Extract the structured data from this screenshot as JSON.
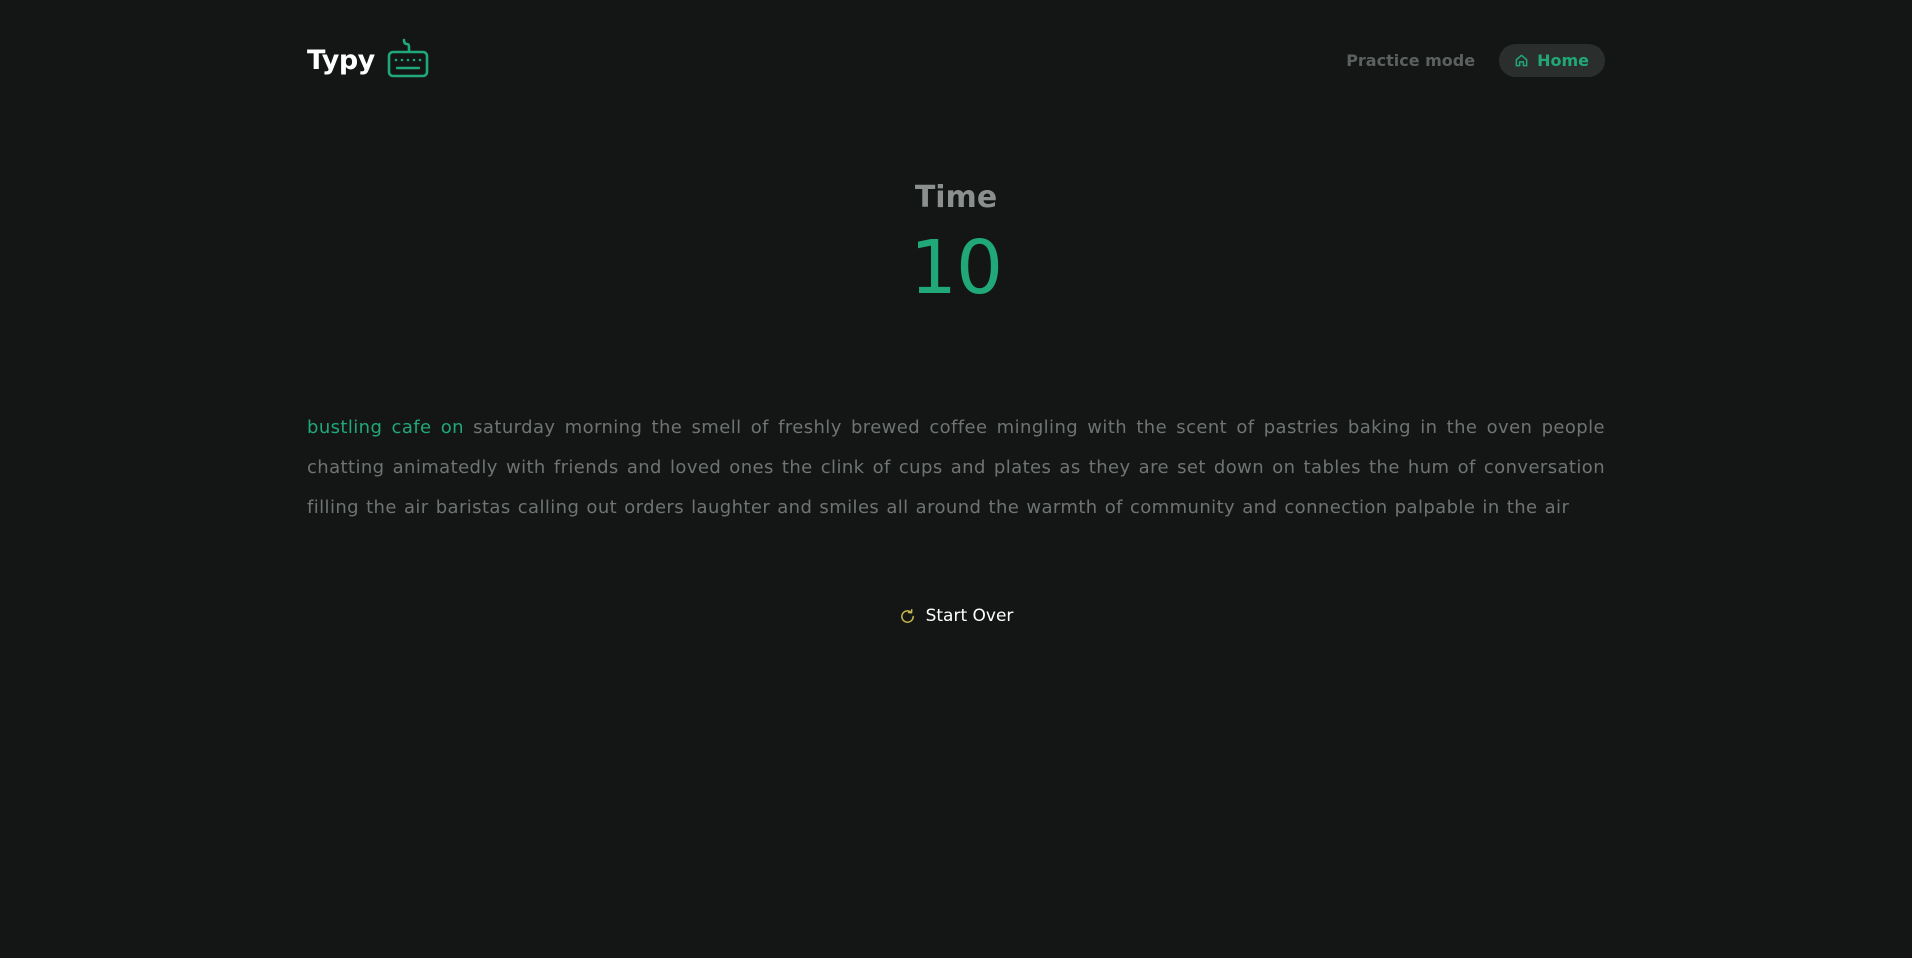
{
  "app": {
    "name": "Typy",
    "logo_icon": "keyboard-icon",
    "accent_color": "#21a878"
  },
  "nav": {
    "practice_label": "Practice mode",
    "home_label": "Home",
    "home_icon": "home-icon"
  },
  "timer": {
    "label": "Time",
    "value": "10"
  },
  "passage": {
    "typed": "bustling cafe on",
    "remaining": "saturday morning the smell of freshly brewed coffee mingling with the scent of pastries baking in the oven people chatting animatedly with friends and loved ones the clink of cups and plates as they are set down on tables the hum of conversation filling the air baristas calling out orders laughter and smiles all around the warmth of community and connection palpable in the air"
  },
  "controls": {
    "restart_label": "Start Over",
    "restart_icon": "refresh-icon"
  }
}
